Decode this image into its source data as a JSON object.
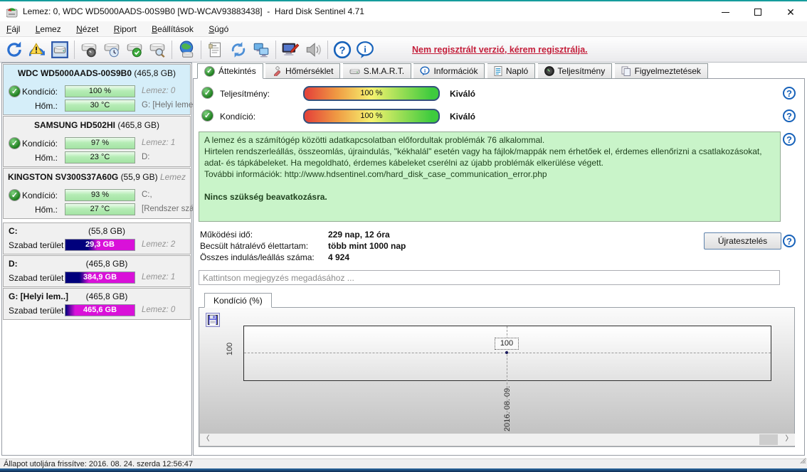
{
  "window": {
    "title": "Lemez: 0, WDC WD5000AADS-00S9B0 [WD-WCAV93883438]  -  Hard Disk Sentinel 4.71",
    "close": "✕"
  },
  "menu": {
    "file": "Fájl",
    "disk": "Lemez",
    "view": "Nézet",
    "report": "Riport",
    "settings": "Beállítások",
    "help": "Súgó"
  },
  "toolbar": {
    "register_text": "Nem regisztrált verzió, kérem regisztrálja."
  },
  "tabs": {
    "overview": "Áttekintés",
    "temperature": "Hőmérséklet",
    "smart": "S.M.A.R.T.",
    "information": "Információk",
    "log": "Napló",
    "performance": "Teljesítmény",
    "alerts": "Figyelmeztetések"
  },
  "labels": {
    "condition": "Kondíció:",
    "temperature": "Hőm.:",
    "free_space": "Szabad terület"
  },
  "disks": [
    {
      "name": "WDC WD5000AADS-00S9B0",
      "size": "(465,8 GB)",
      "condition": "100 %",
      "temp": "30 °C",
      "right1": "Lemez: 0",
      "right2": "G: [Helyi leme",
      "header_right": ""
    },
    {
      "name": "SAMSUNG HD502HI",
      "size": "(465,8 GB)",
      "condition": "97 %",
      "temp": "23 °C",
      "right1": "Lemez: 1",
      "right2": "D:",
      "header_right": ""
    },
    {
      "name": "KINGSTON SV300S37A60G",
      "size": "(55,9 GB)",
      "condition": "93 %",
      "temp": "27 °C",
      "right1": "C:,",
      "right2": "[Rendszer szá",
      "header_right": "Lemez"
    }
  ],
  "partitions": [
    {
      "name": "C:",
      "size": "(55,8 GB)",
      "free": "29,3 GB",
      "right": "Lemez: 2",
      "bar_style": "--used:32%"
    },
    {
      "name": "D:",
      "size": "(465,8 GB)",
      "free": "384,9 GB",
      "right": "Lemez: 1",
      "bar_style": "--used:20%"
    },
    {
      "name": "G: [Helyi lem..]",
      "size": "(465,8 GB)",
      "free": "465,6 GB",
      "right": "Lemez: 0",
      "bar_style": "--used:0%"
    }
  ],
  "overview": {
    "perf_label": "Teljesítmény:",
    "perf_value": "100 %",
    "perf_rating": "Kiváló",
    "cond_label": "Kondíció:",
    "cond_value": "100 %",
    "cond_rating": "Kiváló",
    "msg_line1": "A lemez és a számítógép közötti adatkapcsolatban előfordultak problémák 76 alkalommal.",
    "msg_line2": "Hirtelen rendszerleállás, összeomlás, újraindulás, \"kékhalál\" esetén vagy ha fájlok/mappák nem érhetőek el, érdemes ellenőrizni a csatlakozásokat, adat- és tápkábeleket. Ha megoldható, érdemes kábeleket cserélni az újabb problémák elkerülése végett.",
    "msg_line3": "További információk: http://www.hdsentinel.com/hard_disk_case_communication_error.php",
    "msg_bold": "Nincs szükség beavatkozásra.",
    "stats": [
      {
        "label": "Működési idő:",
        "value": "229 nap, 12 óra"
      },
      {
        "label": "Becsült hátralévő élettartam:",
        "value": "több mint 1000 nap"
      },
      {
        "label": "Összes indulás/leállás száma:",
        "value": "4 924"
      }
    ],
    "retest_button": "Újratesztelés",
    "comment_placeholder": "Kattintson megjegyzés megadásához ..."
  },
  "chart": {
    "tab_label": "Kondíció  (%)",
    "y_tick": "100",
    "point_label": "100",
    "x_tick": "2016. 08. 09."
  },
  "chart_data": {
    "type": "line",
    "title": "Kondíció (%)",
    "x": [
      "2016. 08. 09."
    ],
    "values": [
      100
    ],
    "ylabel": "",
    "legend": false
  },
  "statusbar": {
    "text": "Állapot utoljára frissítve: 2016. 08. 24. szerda 12:56:47"
  }
}
